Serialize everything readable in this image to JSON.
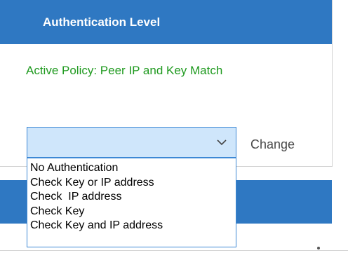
{
  "panel": {
    "title": "Authentication Level",
    "active_policy": "Active Policy: Peer IP and Key Match"
  },
  "auth_select": {
    "selected_value": "",
    "options": [
      "No Authentication",
      "Check Key or IP address",
      "Check  IP address",
      "Check Key",
      "Check Key and IP address"
    ]
  },
  "change_label": "Change",
  "colors": {
    "header_blue": "#2f78c2",
    "policy_green": "#1f9a1f",
    "select_fill": "#cfe6fb",
    "select_border": "#3d88d5"
  },
  "icons": {
    "dropdown": "chevron-down-icon"
  }
}
